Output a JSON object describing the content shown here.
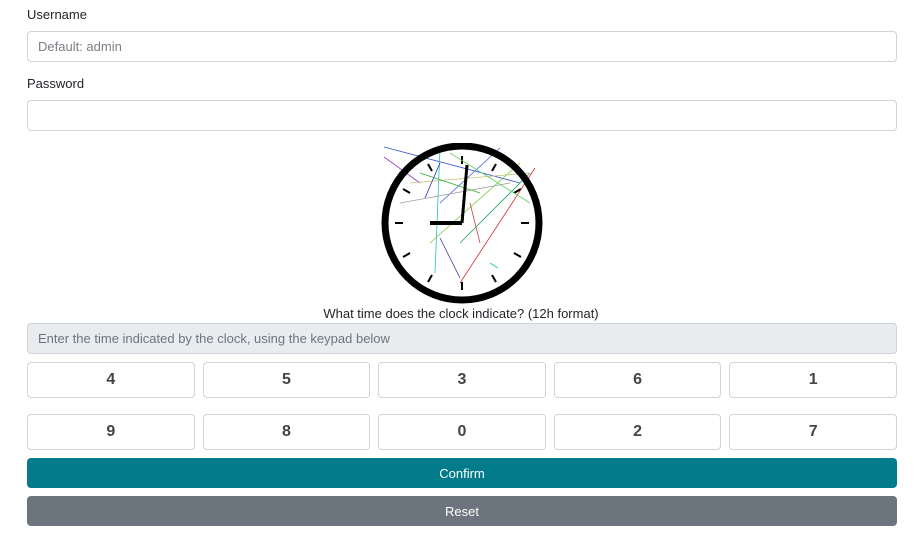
{
  "username": {
    "label": "Username",
    "placeholder": "Default: admin",
    "value": ""
  },
  "password": {
    "label": "Password",
    "value": ""
  },
  "captcha": {
    "question": "What time does the clock indicate? (12h format)",
    "input_placeholder": "Enter the time indicated by the clock, using the keypad below",
    "input_value": "",
    "keypad_rows": [
      [
        "4",
        "5",
        "3",
        "6",
        "1"
      ],
      [
        "9",
        "8",
        "0",
        "2",
        "7"
      ]
    ]
  },
  "buttons": {
    "confirm_label": "Confirm",
    "reset_label": "Reset"
  },
  "colors": {
    "confirm_bg": "#027b8a",
    "reset_bg": "#6c757d"
  }
}
